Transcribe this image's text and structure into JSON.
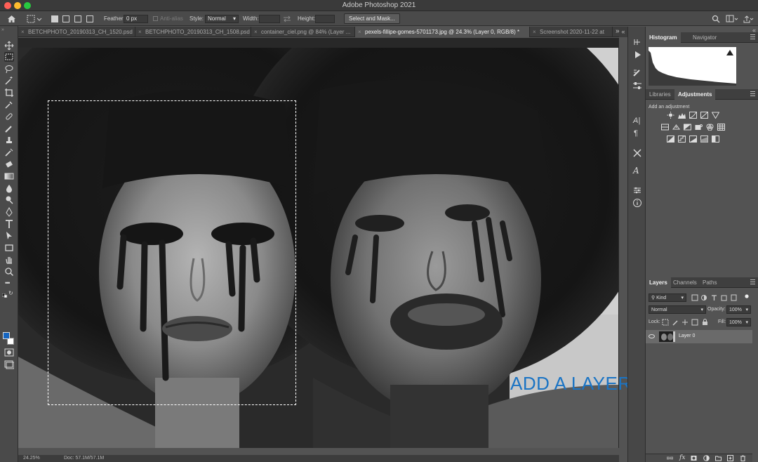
{
  "app": {
    "title": "Adobe Photoshop 2021"
  },
  "options_bar": {
    "feather_label": "Feather:",
    "feather_value": "0 px",
    "anti_alias_label": "Anti-alias",
    "style_label": "Style:",
    "style_value": "Normal",
    "width_label": "Width:",
    "height_label": "Height:",
    "select_mask_button": "Select and Mask..."
  },
  "tabs": [
    {
      "label": "BETCHPHOTO_20190313_CH_1520.psd"
    },
    {
      "label": "BETCHPHOTO_20190313_CH_1508.psd"
    },
    {
      "label": "container_ciel.png @ 84% (Layer ..."
    },
    {
      "label": "pexels-fillipe-gomes-5701173.jpg @ 24.3% (Layer 0, RGB/8) *",
      "active": true
    },
    {
      "label": "Screenshot 2020-11-22 at"
    }
  ],
  "tabs_overflow": "»",
  "canvas": {
    "annotation": "ADD A LAYER MASK",
    "annotation_color": "#1b74c4"
  },
  "status_bar": {
    "zoom": "24.25%",
    "doc_info": "Doc: 57.1M/57.1M"
  },
  "panels": {
    "top_tabs": [
      "Histogram",
      "Navigator"
    ],
    "mid_tabs": [
      "Libraries",
      "Adjustments"
    ],
    "adjustments_label": "Add an adjustment",
    "layers_tabs": [
      "Layers",
      "Channels",
      "Paths"
    ],
    "kind_filter": "Kind",
    "blend_mode": "Normal",
    "opacity_label": "Opacity:",
    "opacity_value": "100%",
    "lock_label": "Lock:",
    "fill_label": "Fill:",
    "fill_value": "100%",
    "layers": [
      {
        "name": "Layer 0",
        "visible": true,
        "selected": true
      }
    ],
    "bottom_icons": [
      "link-icon",
      "fx-icon",
      "add-layer-mask-icon",
      "adjustment-layer-icon",
      "group-folder-icon",
      "new-layer-icon",
      "trash-icon"
    ]
  },
  "colors": {
    "foreground": "#1565c0",
    "background": "#ffffff",
    "accent": "#1b74c4"
  }
}
